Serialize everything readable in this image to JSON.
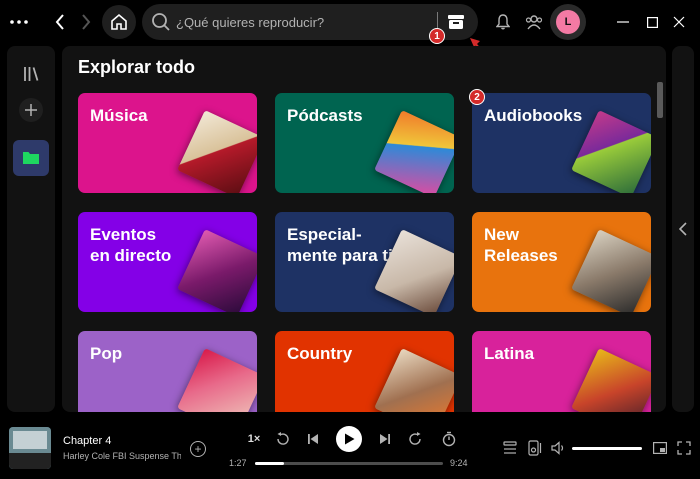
{
  "search": {
    "placeholder": "¿Qué quieres reproducir?"
  },
  "user": {
    "avatar_initial": "L"
  },
  "main": {
    "title": "Explorar todo",
    "cards": [
      {
        "label": "Música",
        "color": "#dc148c"
      },
      {
        "label": "Pódcasts",
        "color": "#006450"
      },
      {
        "label": "Audiobooks",
        "color": "#1e3264"
      },
      {
        "label": "Eventos\nen directo",
        "color": "#8400e7"
      },
      {
        "label": "Especial-\nmente para ti",
        "color": "#1e3264"
      },
      {
        "label": "New\nReleases",
        "color": "#e8730d"
      },
      {
        "label": "Pop",
        "color": "#9c62c8"
      },
      {
        "label": "Country",
        "color": "#e13300"
      },
      {
        "label": "Latina",
        "color": "#d8229b"
      }
    ]
  },
  "annotations": {
    "marker_1": "1",
    "marker_2": "2"
  },
  "player": {
    "track_title": "Chapter 4",
    "track_subtitle": "Harley Cole FBI Suspense Th",
    "speed": "1×",
    "time_current": "1:27",
    "time_total": "9:24",
    "progress_fraction": 0.154
  }
}
